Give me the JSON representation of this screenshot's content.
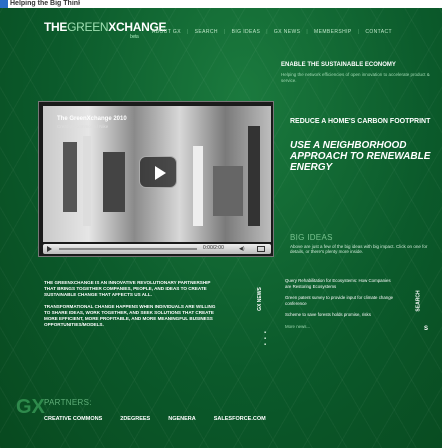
{
  "browser_tab": {
    "label": "Helping the Big Thinkers"
  },
  "logo": {
    "part1": "THE",
    "part2": "GREEN",
    "part3": "XCHANGE",
    "badge": "beta"
  },
  "nav": [
    "ABOUT GX",
    "SEARCH",
    "BIG IDEAS",
    "GX NEWS",
    "MEMBERSHIP",
    "CONTACT"
  ],
  "tagline": {
    "title": "ENABLE THE SUSTAINABLE ECONOMY",
    "subtitle": "Helping the network efficiencies of open innovation to accelerate product & service."
  },
  "video": {
    "title": "The GreenXchange 2010",
    "subtitle": "Creative Commons / Nike",
    "time": "0:00/2:00"
  },
  "big_ideas": {
    "item1": "REDUCE A HOME'S CARBON FOOTPRINT",
    "item2": "USE A NEIGHBORHOOD APPROACH TO RENEWABLE ENERGY",
    "heading": "BIG IDEAS",
    "description": "Above are just a few of the big ideas with big impact. Click on one for details, or there's plenty more inside."
  },
  "intro": {
    "p1": "THE GREENXCHANGE IS AN INNOVATIVE REVOLUTIONARY PARTNERSHIP THAT BRINGS TOGETHER COMPANIES, PEOPLE, AND IDEAS TO CREATE SUSTAINABLE CHANGE THAT AFFECTS US ALL.",
    "p2": "TRANSFORMATIONAL CHANGE HAPPENS WHEN INDIVIDUALS ARE WILLING TO SHARE IDEAS, WORK TOGETHER, AND SEEK SOLUTIONS THAT CREATE MORE EFFICIENT, MORE PROFITABLE, AND MORE MEANINGFUL BUSINESS OPPORTUNITIES/MODELS."
  },
  "news": {
    "tab_label": "GX NEWS",
    "items": [
      "Query Rehabilitation for Ecosystems: How Companies are Restoring Ecosystems",
      "Green patent survey to provide input for climate change conference",
      "Scheme to save forests holds promise, risks"
    ],
    "more": "More news..."
  },
  "search": {
    "tab_label": "SEARCH",
    "ellipsis": "S"
  },
  "partners": {
    "mark": "GX",
    "heading": "PARTNERS:",
    "items": [
      "CREATIVE COMMONS",
      "2DEGREES",
      "NGENERA",
      "SALESFORCE.COM"
    ]
  },
  "colors": {
    "background": "#0b5a2b",
    "accent": "#79c38f"
  }
}
